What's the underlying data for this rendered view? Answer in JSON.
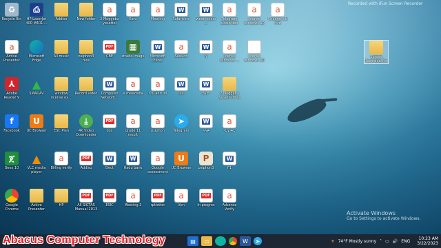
{
  "watermark": "Recorded with iFun Screen Recorder",
  "activation": {
    "title": "Activate Windows",
    "subtitle": "Go to Settings to activate Windows."
  },
  "brand_overlay": "Abacus Computer Technology",
  "taskbar": {
    "weather": "74°F  Mostly sunny",
    "time": "10:23 AM",
    "date": "3/22/2023",
    "language": "ENG"
  },
  "icons": [
    {
      "label": "Recycle Bin",
      "icon": "recycle-bin-icon"
    },
    {
      "label": "HP LaserJet 400 M401 ...",
      "icon": "printer-icon"
    },
    {
      "label": "Addiso",
      "icon": "folder-icon"
    },
    {
      "label": "New folder",
      "icon": "folder-icon"
    },
    {
      "label": "2 Meggeba yesettel",
      "icon": "acrobat-icon"
    },
    {
      "label": "Esru",
      "icon": "acrobat-icon"
    },
    {
      "label": "Meeting",
      "icon": "acrobat-icon"
    },
    {
      "label": "Safaricom",
      "icon": "word-icon"
    },
    {
      "label": "west gojam ...",
      "icon": "word-icon"
    },
    {
      "label": "Telegram subscriber",
      "icon": "acrobat-icon"
    },
    {
      "label": "license windows 10",
      "icon": "acrobat-icon"
    },
    {
      "label": "Change job info",
      "icon": "acrobat-icon"
    },
    {
      "label": "Active Presenter",
      "icon": "acrobat-icon"
    },
    {
      "label": "Microsoft Edge",
      "icon": "edge-icon"
    },
    {
      "label": "All music",
      "icon": "folder-icon"
    },
    {
      "label": "psiphon3 files",
      "icon": "folder-icon"
    },
    {
      "label": "CBE",
      "icon": "pdf-icon"
    },
    {
      "label": "strade image",
      "icon": "image-icon"
    },
    {
      "label": "Microsoft Excel Introd...",
      "icon": "word-icon"
    },
    {
      "label": "Session",
      "icon": "acrobat-icon"
    },
    {
      "label": "ly",
      "icon": "word-icon"
    },
    {
      "label": "license windows ...",
      "icon": "acrobat-icon"
    },
    {
      "label": "license windows 10 ...",
      "icon": "blank-icon"
    },
    {
      "label": "Adobe Reader 9",
      "icon": "adobe-reader-icon"
    },
    {
      "label": "SMADAV",
      "icon": "smadav-icon"
    },
    {
      "label": "window license ex...",
      "icon": "folder-icon"
    },
    {
      "label": "Record video",
      "icon": "folder-icon"
    },
    {
      "label": "Computer Network...",
      "icon": "word-icon"
    },
    {
      "label": "e mewdaba",
      "icon": "acrobat-icon"
    },
    {
      "label": "f20 add ini",
      "icon": "acrobat-icon"
    },
    {
      "label": "lax",
      "icon": "word-icon"
    },
    {
      "label": "ሰላም",
      "icon": "word-icon"
    },
    {
      "label": "2 Meggeba yesetle files",
      "icon": "folder-icon"
    },
    {
      "label": "Facebook",
      "icon": "facebook-icon"
    },
    {
      "label": "UC Browser",
      "icon": "uc-browser-icon"
    },
    {
      "label": "ESC Plan",
      "icon": "folder-icon"
    },
    {
      "label": "4K Video Downloader",
      "icon": "video-downloader-icon"
    },
    {
      "label": "doc",
      "icon": "pdf-icon"
    },
    {
      "label": "grade 11 result",
      "icon": "acrobat-icon"
    },
    {
      "label": "psiphon",
      "icon": "acrobat-icon"
    },
    {
      "label": "Telegram",
      "icon": "telegram-icon"
    },
    {
      "label": "ኣለቃ",
      "icon": "word-icon"
    },
    {
      "label": "ዲቤ ዋቤ",
      "icon": "acrobat-icon"
    },
    {
      "label": "Geez 10",
      "icon": "geez-icon"
    },
    {
      "label": "VLC media player",
      "icon": "vlc-icon"
    },
    {
      "label": "Billing verify",
      "icon": "acrobat-icon"
    },
    {
      "label": "Addisu",
      "icon": "pdf-icon"
    },
    {
      "label": "Dect",
      "icon": "word-icon"
    },
    {
      "label": "Hadu bank",
      "icon": "word-icon"
    },
    {
      "label": "Google assessment verify",
      "icon": "acrobat-icon"
    },
    {
      "label": "UC Browser",
      "icon": "uc-browser-icon"
    },
    {
      "label": "psiphon3",
      "icon": "psiphon-icon"
    },
    {
      "label": "F1",
      "icon": "word-icon"
    },
    {
      "label": "Google Chrome",
      "icon": "chrome-icon"
    },
    {
      "label": "Active Presenter",
      "icon": "folder-icon"
    },
    {
      "label": "HP",
      "icon": "folder-icon"
    },
    {
      "label": "All SIGTAS Manual 2013 ...",
      "icon": "pdf-icon"
    },
    {
      "label": "ESIC",
      "icon": "pdf-icon"
    },
    {
      "label": "Meeting 2",
      "icon": "acrobat-icon"
    },
    {
      "label": "rptletter",
      "icon": "pdf-icon"
    },
    {
      "label": "Vpn",
      "icon": "acrobat-icon"
    },
    {
      "label": "In progres",
      "icon": "pdf-icon"
    },
    {
      "label": "Adsense Verify",
      "icon": "acrobat-icon"
    },
    {
      "label": "Screen Recorded_flo...",
      "icon": "folder-icon"
    }
  ]
}
